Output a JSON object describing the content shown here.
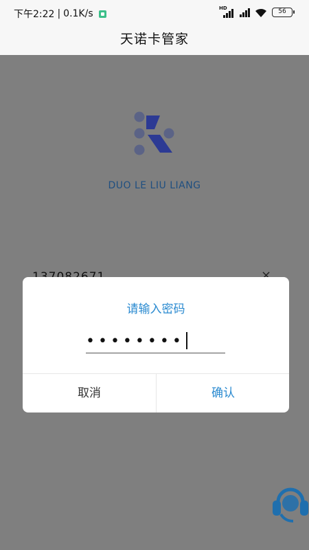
{
  "status": {
    "time": "下午2:22",
    "speed": "0.1K/s",
    "battery": "56",
    "hd": "HD"
  },
  "header": {
    "title": "天诺卡管家"
  },
  "login": {
    "brand": "DUO LE LIU LIANG",
    "phone": "137082671",
    "clear_icon": "×"
  },
  "dialog": {
    "title": "请输入密码",
    "password_mask": "••••••••",
    "cancel": "取消",
    "confirm": "确认"
  },
  "colors": {
    "accent": "#2a8ad0",
    "brand": "#1f4f80",
    "logo": "#2c3a94",
    "overlay": "#7f7f7f"
  },
  "icons": {
    "logo": "k-logo-icon",
    "support": "headset-icon",
    "clear": "close-icon"
  }
}
